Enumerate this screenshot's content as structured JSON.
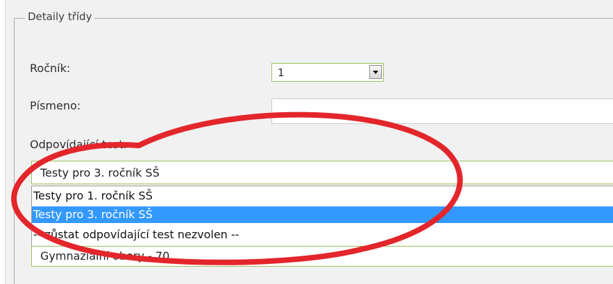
{
  "fieldset": {
    "legend": "Detaily třídy"
  },
  "rocnik": {
    "label": "Ročník:",
    "value": "1"
  },
  "pismeno": {
    "label": "Písmeno:",
    "value": ""
  },
  "test": {
    "label": "Odpovídající test:",
    "selected": "Testy pro 3. ročník SŠ",
    "options": [
      "Testy pro 1. ročník SŠ",
      "Testy pro 3. ročník SŠ",
      "-- zůstat odpovídající test nezvolen --"
    ],
    "highlighted_index": 1
  },
  "obor": {
    "value": "Gymnaziální obory - 70"
  },
  "annotation": {
    "color": "#e3262b",
    "shape": "ellipse"
  }
}
